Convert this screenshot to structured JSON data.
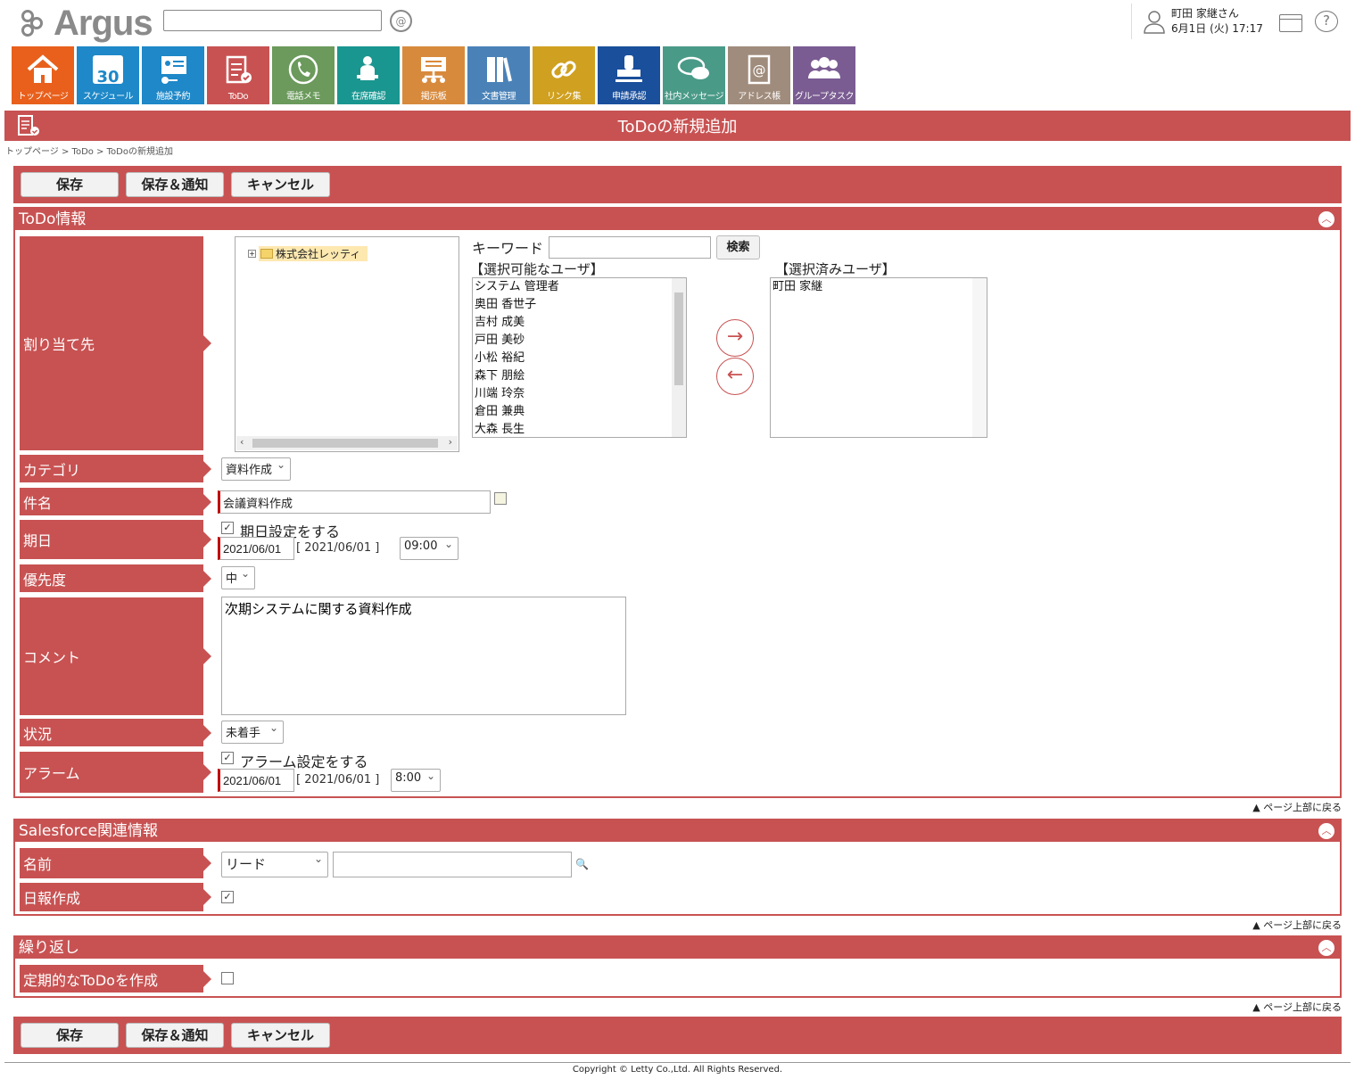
{
  "app": {
    "logo": "Argus"
  },
  "search": {
    "placeholder": ""
  },
  "user": {
    "name": "町田 家継さん",
    "datetime": "6月1日 (火) 17:17"
  },
  "nav": [
    {
      "label": "トップページ",
      "color": "#e8601c",
      "icon": "home-icon"
    },
    {
      "label": "スケジュール",
      "color": "#1e88c8",
      "icon": "calendar-icon",
      "extra": "30"
    },
    {
      "label": "施設予約",
      "color": "#1e88c8",
      "icon": "facility-icon"
    },
    {
      "label": "ToDo",
      "color": "#c85252",
      "icon": "todo-icon"
    },
    {
      "label": "電話メモ",
      "color": "#6b9a5c",
      "icon": "phone-icon"
    },
    {
      "label": "在席確認",
      "color": "#1a9690",
      "icon": "presence-icon"
    },
    {
      "label": "掲示板",
      "color": "#d88a3c",
      "icon": "board-icon"
    },
    {
      "label": "文書管理",
      "color": "#4a82b8",
      "icon": "document-icon"
    },
    {
      "label": "リンク集",
      "color": "#d0a020",
      "icon": "link-icon"
    },
    {
      "label": "申請承認",
      "color": "#1a4f9c",
      "icon": "stamp-icon"
    },
    {
      "label": "社内メッセージ",
      "color": "#4a9a88",
      "icon": "message-icon"
    },
    {
      "label": "アドレス帳",
      "color": "#a08c7c",
      "icon": "address-book-icon"
    },
    {
      "label": "グループタスク",
      "color": "#7a5c92",
      "icon": "group-task-icon"
    }
  ],
  "page": {
    "title": "ToDoの新規追加",
    "breadcrumb": "トップページ > ToDo > ToDoの新規追加"
  },
  "buttons": {
    "save": "保存",
    "save_notify": "保存＆通知",
    "cancel": "キャンセル"
  },
  "todo": {
    "section_title": "ToDo情報",
    "assign_label": "割り当て先",
    "tree_root": "株式会社レッティ",
    "keyword_label": "キーワード",
    "keyword_value": "",
    "search_button": "検索",
    "available_label": "【選択可能なユーザ】",
    "selected_label": "【選択済みユーザ】",
    "available_users": [
      "システム 管理者",
      "奥田 香世子",
      "吉村 成美",
      "戸田 美砂",
      "小松 裕紀",
      "森下 朋絵",
      "川端 玲奈",
      "倉田 兼典",
      "大森 長生"
    ],
    "selected_users": [
      "町田 家継"
    ],
    "category_label": "カテゴリ",
    "category_value": "資料作成",
    "subject_label": "件名",
    "subject_value": "会議資料作成",
    "due_label": "期日",
    "due_check_label": "期日設定をする",
    "due_checked": true,
    "due_date": "2021/06/01",
    "due_date_display": "[ 2021/06/01 ]",
    "due_time": "09:00",
    "priority_label": "優先度",
    "priority_value": "中",
    "comment_label": "コメント",
    "comment_value": "次期システムに関する資料作成",
    "status_label": "状況",
    "status_value": "未着手",
    "alarm_label": "アラーム",
    "alarm_check_label": "アラーム設定をする",
    "alarm_checked": true,
    "alarm_date": "2021/06/01",
    "alarm_date_display": "[ 2021/06/01 ]",
    "alarm_time": "8:00"
  },
  "back_to_top": "▲ ページ上部に戻る",
  "salesforce": {
    "section_title": "Salesforce関連情報",
    "name_label": "名前",
    "name_type": "リード",
    "name_value": "",
    "report_label": "日報作成",
    "report_checked": true
  },
  "repeat": {
    "section_title": "繰り返し",
    "periodic_label": "定期的なToDoを作成",
    "periodic_checked": false
  },
  "footer": {
    "copyright": "Copyright © Letty Co.,Ltd. All Rights Reserved."
  }
}
